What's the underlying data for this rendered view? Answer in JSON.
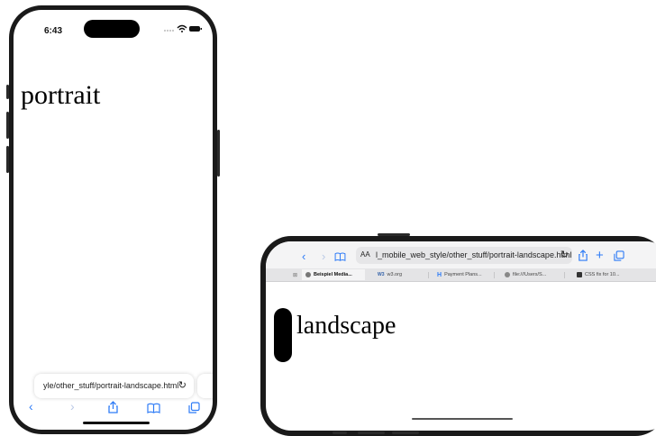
{
  "portrait": {
    "status_time": "6:43",
    "page_text": "portrait",
    "url": "yle/other_stuff/portrait-landscape.html",
    "reload_icon": "reload-icon",
    "toolbar": {
      "back_icon": "chevron-left-icon",
      "forward_icon": "chevron-right-icon",
      "share_icon": "share-icon",
      "bookmarks_icon": "book-icon",
      "tabs_icon": "tabs-icon"
    }
  },
  "landscape": {
    "page_text": "landscape",
    "url_aa": "AA",
    "url": "l_mobile_web_style/other_stuff/portrait-landscape.html",
    "tabs": [
      {
        "label": "Beispiel Media..."
      },
      {
        "label": "w3.org"
      },
      {
        "label": "Payment Plans..."
      },
      {
        "label": "file:///Users/S..."
      },
      {
        "label": "CSS fix for 10..."
      }
    ]
  },
  "colors": {
    "accent": "#2f7cf6",
    "frame": "#1a1a1a"
  }
}
